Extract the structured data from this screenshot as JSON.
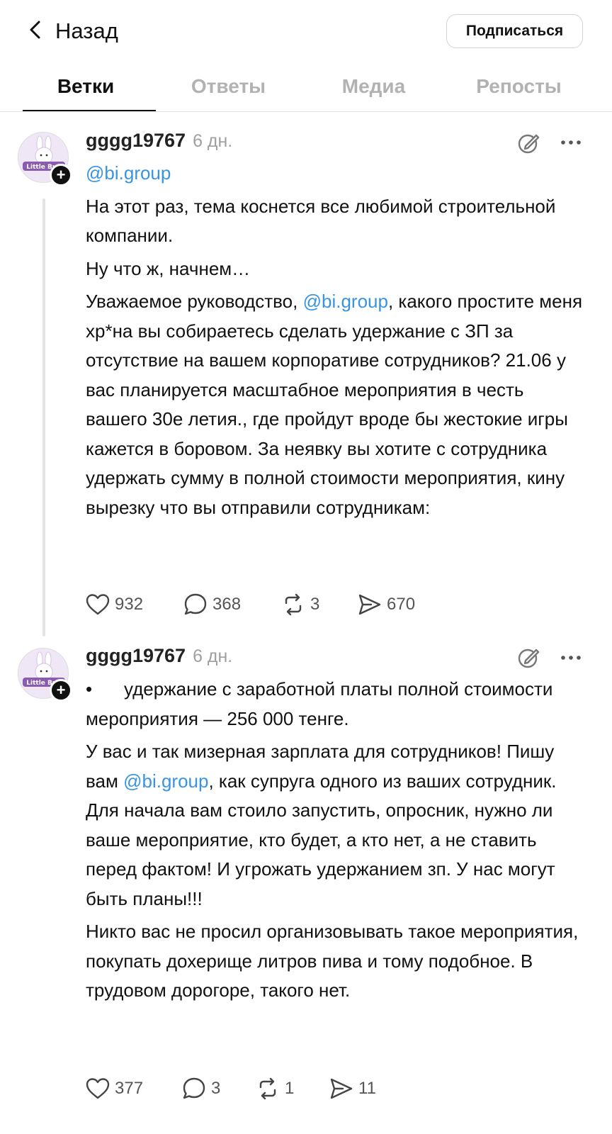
{
  "header": {
    "back_label": "Назад",
    "subscribe_label": "Подписаться"
  },
  "tabs": [
    {
      "label": "Ветки",
      "active": true
    },
    {
      "label": "Ответы",
      "active": false
    },
    {
      "label": "Медиа",
      "active": false
    },
    {
      "label": "Репосты",
      "active": false
    }
  ],
  "posts": [
    {
      "username": "gggg19767",
      "time": "6 дн.",
      "avatar_text": "Little Bun",
      "mention_line": "@bi.group",
      "paragraphs": [
        "На этот раз, тема коснется все любимой строительной компании.",
        "Ну что ж, начнем…",
        "Уважаемое руководство,"
      ],
      "mention_inline": "@bi.group",
      "para3_rest": ", какого простите меня хр*на вы собираетесь сделать удержание с ЗП за отсутствие на вашем корпоративе сотрудников? 21.06 у вас планируется масштабное мероприятия в честь вашего 30е летия., где пройдут вроде бы жестокие игры кажется в боровом. За неявку вы хотите с сотрудника удержать сумму в полной стоимости мероприятия, кину вырезку что вы отправили сотрудникам:",
      "likes": "932",
      "replies": "368",
      "reposts": "3",
      "shares": "670"
    },
    {
      "username": "gggg19767",
      "time": "6 дн.",
      "avatar_text": "Little Bun",
      "bullet": "•",
      "bullet_text": "удержание с заработной платы полной стоимости мероприятия — 256 000 тенге.",
      "para2_start": "У вас и так мизерная зарплата для сотрудников! Пишу вам ",
      "mention_inline": "@bi.group",
      "para2_rest": ", как супруга одного из ваших сотрудник. Для начала вам стоило запустить, опросник, нужно ли ваше мероприятие, кто будет, а кто нет, а не ставить перед фактом! И угрожать удержанием зп. У нас могут быть планы!!!",
      "para3": "Никто вас не просил организовывать такое мероприятия, покупать дохерище литров пива и тому подобное. В трудовом дорогоре, такого нет.",
      "likes": "377",
      "replies": "3",
      "reposts": "1",
      "shares": "11"
    }
  ]
}
